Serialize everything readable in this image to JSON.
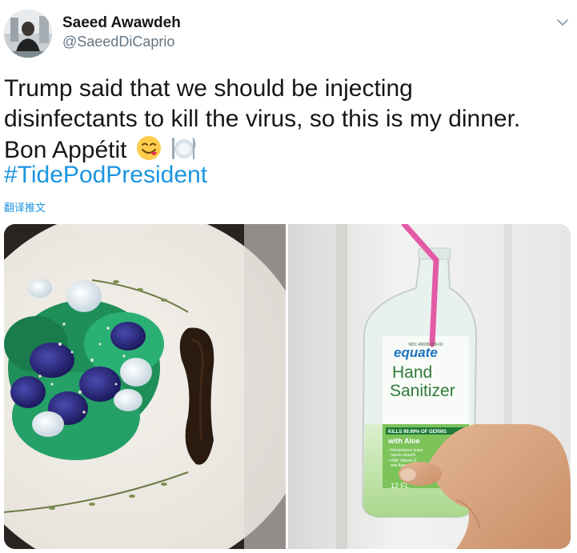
{
  "author": {
    "name": "Saeed Awawdeh",
    "handle": "@SaeedDiCaprio"
  },
  "tweet": {
    "line1": "Trump said that we should be injecting",
    "line2": "disinfectants to kill the virus, so this is my dinner.",
    "line3": "Bon Appétit",
    "hashtag": "#TidePodPresident",
    "translate_label": "翻译推文"
  },
  "icons": {
    "caret": "chevron-down-icon",
    "emoji1": "yum-face-emoji",
    "emoji2": "plate-cutlery-emoji"
  },
  "bottle": {
    "brand": "equate",
    "product_line1": "Hand",
    "product_line2": "Sanitizer",
    "claim": "KILLS 99.99% OF GERMS",
    "with_aloe": "with Aloe",
    "bullet1": "• Moisturizers leave",
    "bullet2": "hands smooth",
    "bullet3": "• With Vitamin E",
    "bullet4": "and Aloe",
    "size": "12 FL",
    "code": "NDC 49035-639-02"
  },
  "colors": {
    "link": "#1b95e0",
    "text": "#14171a",
    "muted": "#657786"
  }
}
